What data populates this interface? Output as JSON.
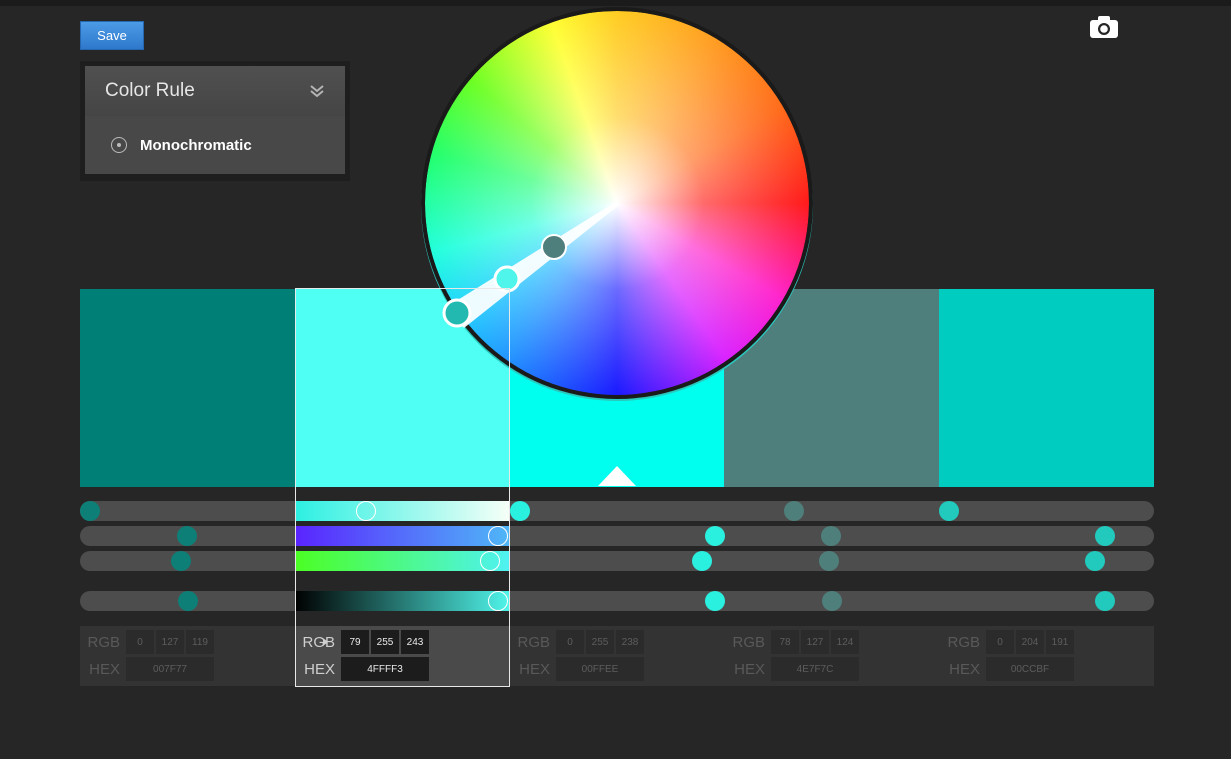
{
  "toolbar": {
    "save_label": "Save",
    "camera_icon": "camera-icon"
  },
  "color_rule": {
    "title": "Color Rule",
    "selected": "Monochromatic",
    "chevron_icon": "double-chevron-down-icon"
  },
  "selected_index": 1,
  "swatches": [
    {
      "hex": "#007F77",
      "rgb": [
        "0",
        "127",
        "119"
      ],
      "hex_label": "007F77"
    },
    {
      "hex": "#4FFFF3",
      "rgb": [
        "79",
        "255",
        "243"
      ],
      "hex_label": "4FFFF3"
    },
    {
      "hex": "#00FFEE",
      "rgb": [
        "0",
        "255",
        "238"
      ],
      "hex_label": "00FFEE"
    },
    {
      "hex": "#4E7F7C",
      "rgb": [
        "78",
        "127",
        "124"
      ],
      "hex_label": "4E7F7C"
    },
    {
      "hex": "#00CCBF",
      "rgb": [
        "0",
        "204",
        "191"
      ],
      "hex_label": "00CCBF"
    }
  ],
  "labels": {
    "rgb": "RGB",
    "hex": "HEX"
  }
}
